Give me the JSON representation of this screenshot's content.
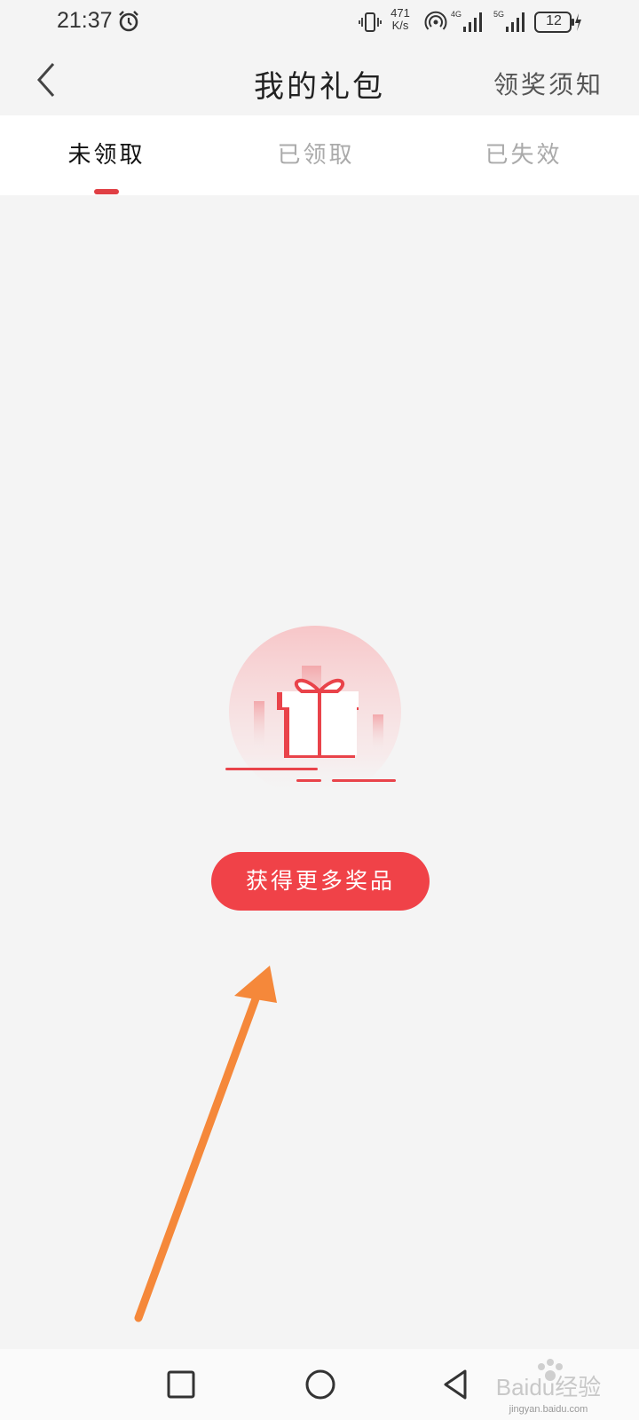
{
  "status_bar": {
    "time": "21:37",
    "net_speed_value": "471",
    "net_speed_unit": "K/s",
    "battery_level": "12",
    "signal1_label": "4G",
    "signal2_label": "5G"
  },
  "header": {
    "title": "我的礼包",
    "rules_link": "领奖须知"
  },
  "tabs": [
    {
      "label": "未领取",
      "active": true
    },
    {
      "label": "已领取",
      "active": false
    },
    {
      "label": "已失效",
      "active": false
    }
  ],
  "empty_state": {
    "button_label": "获得更多奖品"
  },
  "colors": {
    "accent": "#f04248",
    "tab_indicator": "#e03f44",
    "annotation_arrow": "#f5883a",
    "background": "#f4f4f4"
  },
  "icons": {
    "alarm": "alarm-icon",
    "vibrate": "vibrate-icon",
    "hotspot": "hotspot-icon",
    "signal": "signal-icon",
    "battery": "battery-icon",
    "back": "chevron-left-icon",
    "gift": "gift-icon",
    "nav_recents": "square-icon",
    "nav_home": "circle-icon",
    "nav_back": "triangle-back-icon"
  },
  "watermark": {
    "logo_text": "Baidu经验",
    "url": "jingyan.baidu.com"
  }
}
